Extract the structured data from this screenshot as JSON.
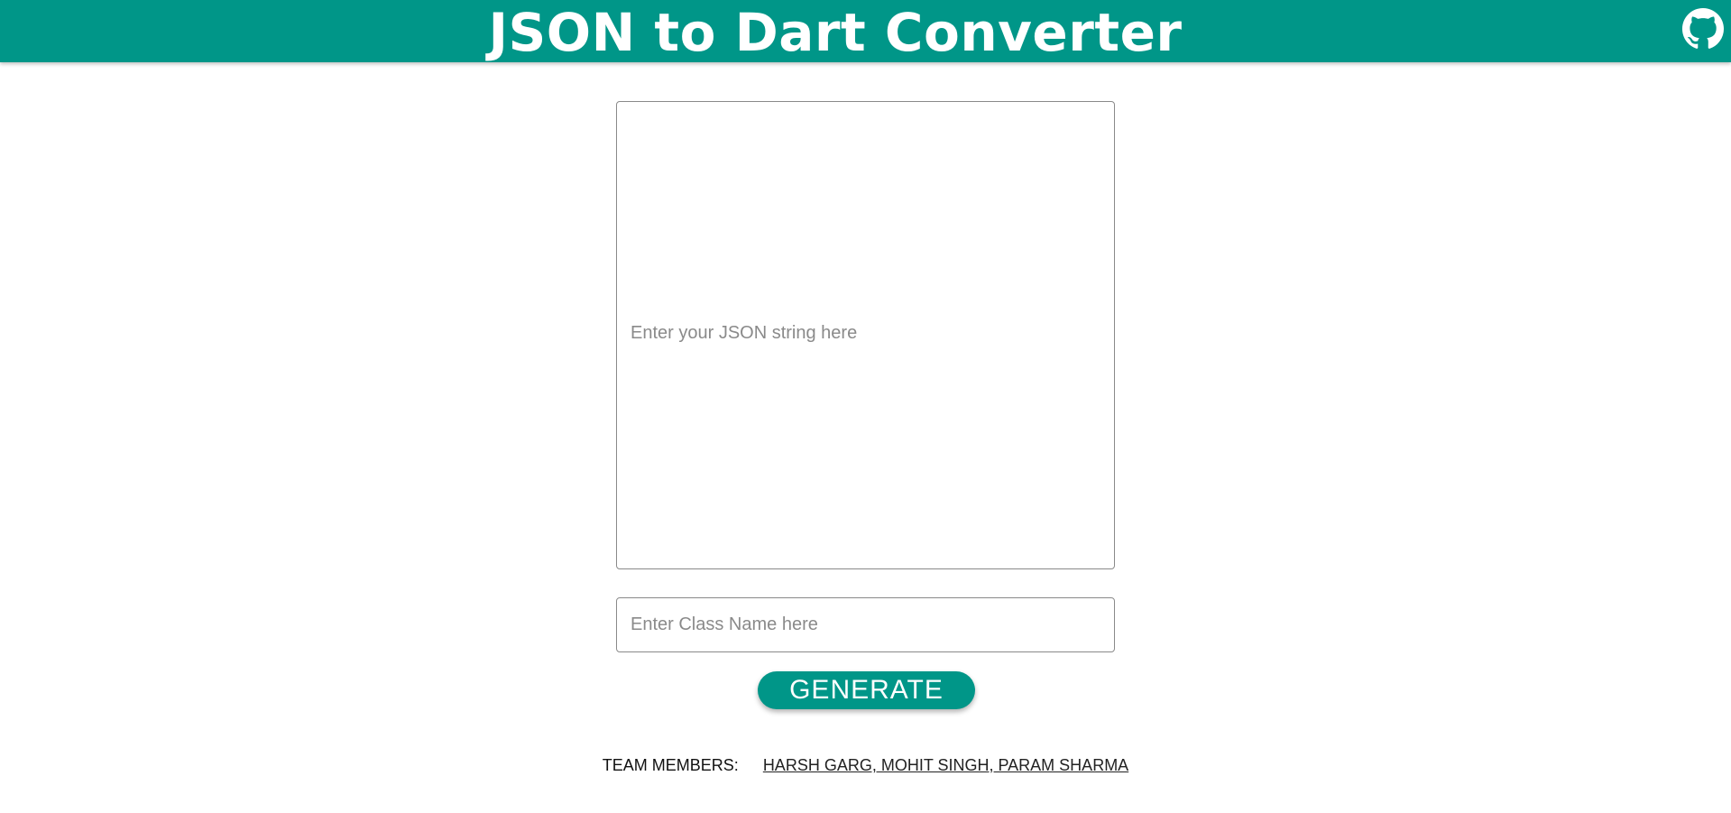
{
  "header": {
    "title": "JSON to Dart Converter",
    "github_icon": "github-icon",
    "background_color": "#009688"
  },
  "form": {
    "json_placeholder": "Enter your JSON string here",
    "json_value": "",
    "class_placeholder": "Enter Class Name here",
    "class_value": "",
    "generate_label": "GENERATE"
  },
  "footer": {
    "team_label": "TEAM MEMBERS:",
    "team_members": "HARSH GARG, MOHIT SINGH, PARAM SHARMA"
  }
}
